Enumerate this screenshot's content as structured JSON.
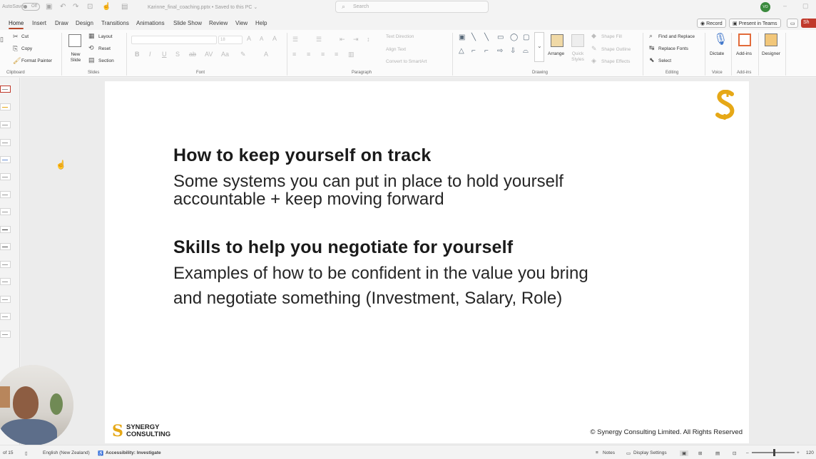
{
  "titlebar": {
    "autosave_label": "AutoSave",
    "autosave_state": "Off",
    "file_name": "Karinne_final_coaching.pptx • Saved to this PC ⌄",
    "search_placeholder": "Search",
    "user_initials": "VO"
  },
  "tabs": [
    "Home",
    "Insert",
    "Draw",
    "Design",
    "Transitions",
    "Animations",
    "Slide Show",
    "Review",
    "View",
    "Help"
  ],
  "actions": {
    "record": "Record",
    "present": "Present in Teams",
    "share": "Sh"
  },
  "ribbon": {
    "clipboard": {
      "cut": "Cut",
      "copy": "Copy",
      "format_painter": "Format Painter",
      "label": "Clipboard"
    },
    "slides": {
      "new_slide": "New Slide",
      "layout": "Layout",
      "reset": "Reset",
      "section": "Section",
      "label": "Slides"
    },
    "font": {
      "size": "18",
      "label": "Font"
    },
    "paragraph": {
      "text_direction": "Text Direction",
      "align_text": "Align Text",
      "convert": "Convert to SmartArt",
      "label": "Paragraph"
    },
    "drawing": {
      "arrange": "Arrange",
      "quick_styles": "Quick Styles",
      "shape_fill": "Shape Fill",
      "shape_outline": "Shape Outline",
      "shape_effects": "Shape Effects",
      "label": "Drawing"
    },
    "editing": {
      "find": "Find and Replace",
      "replace_fonts": "Replace Fonts",
      "select": "Select",
      "label": "Editing"
    },
    "voice": {
      "dictate": "Dictate",
      "label": "Voice"
    },
    "addins": {
      "addins": "Add-ins",
      "label": "Add-ins"
    },
    "designer": {
      "designer": "Designer"
    }
  },
  "slide": {
    "heading1": "How to keep yourself on track",
    "body1_line1": "Some systems you can put in place to hold yourself",
    "body1_line2": "accountable + keep moving forward",
    "heading2": "Skills to help you negotiate for yourself",
    "body2_line1": "Examples of how to be confident in the value you bring",
    "body2_line2": "and negotiate something (Investment, Salary, Role)",
    "footer_logo_line1": "SYNERGY",
    "footer_logo_line2": "CONSULTING",
    "copyright": "© Synergy Consulting Limited. All Rights Reserved",
    "brand_color": "#e6a817"
  },
  "status": {
    "slide_count": "of 15",
    "language": "English (New Zealand)",
    "accessibility": "Accessibility: Investigate",
    "notes": "Notes",
    "display_settings": "Display Settings",
    "zoom": "120"
  }
}
